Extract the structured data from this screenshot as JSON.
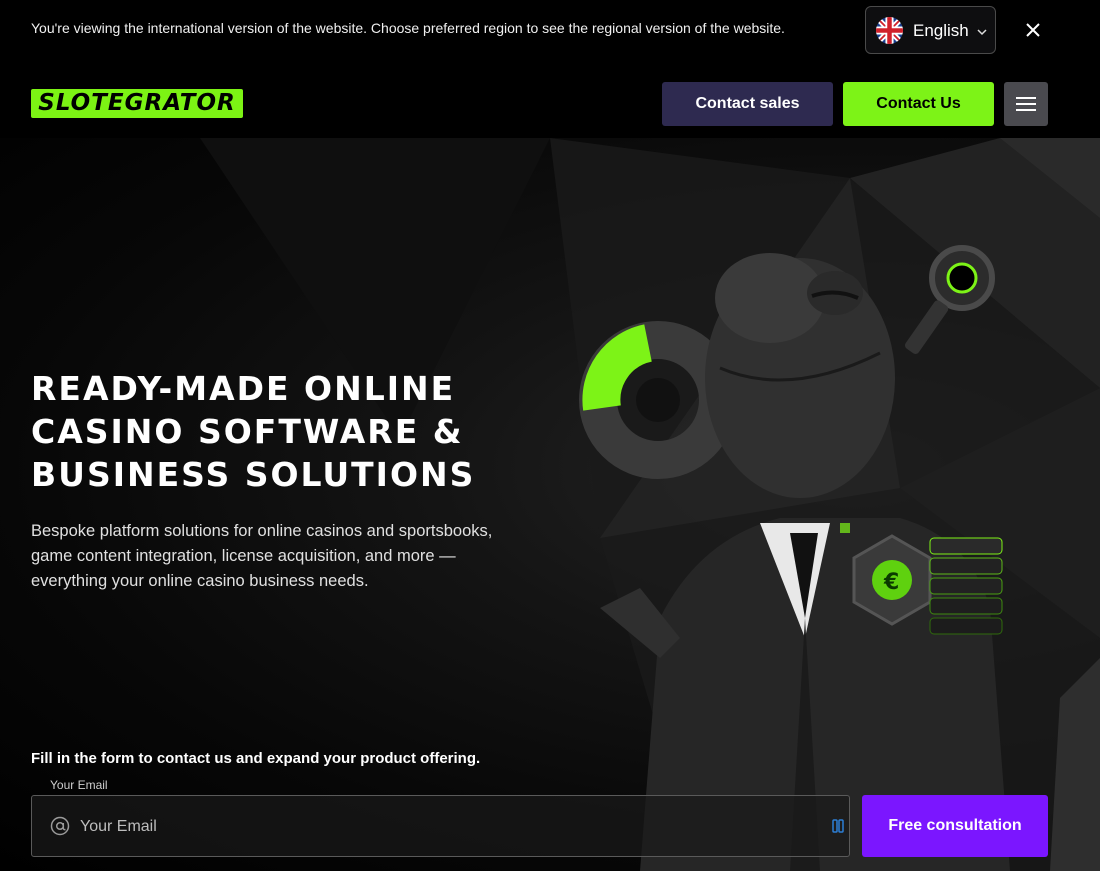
{
  "notice": {
    "text": "You're viewing the international version of the website. Choose preferred region to see the regional version of the website.",
    "language": "English",
    "flag_icon": "uk-flag-icon",
    "close_icon": "close-icon"
  },
  "header": {
    "logo_text": "SLOTEGRATOR",
    "contact_sales": "Contact sales",
    "contact_us": "Contact Us",
    "menu_icon": "hamburger-menu-icon"
  },
  "hero": {
    "headline": "READY-MADE ONLINE CASINO SOFTWARE & BUSINESS SOLUTIONS",
    "subtext": "Bespoke platform solutions for online casinos and sportsbooks, game content integration, license acquisition, and more — everything your online casino business needs.",
    "form_intro": "Fill in the form to contact us and expand your product offering.",
    "email_label": "Your Email",
    "email_placeholder": "Your Email",
    "email_value": "",
    "submit_label": "Free consultation"
  },
  "colors": {
    "accent_green": "#7df317",
    "sales_button": "#2e2a50",
    "cta_purple": "#7b16ff",
    "background": "#000000"
  }
}
